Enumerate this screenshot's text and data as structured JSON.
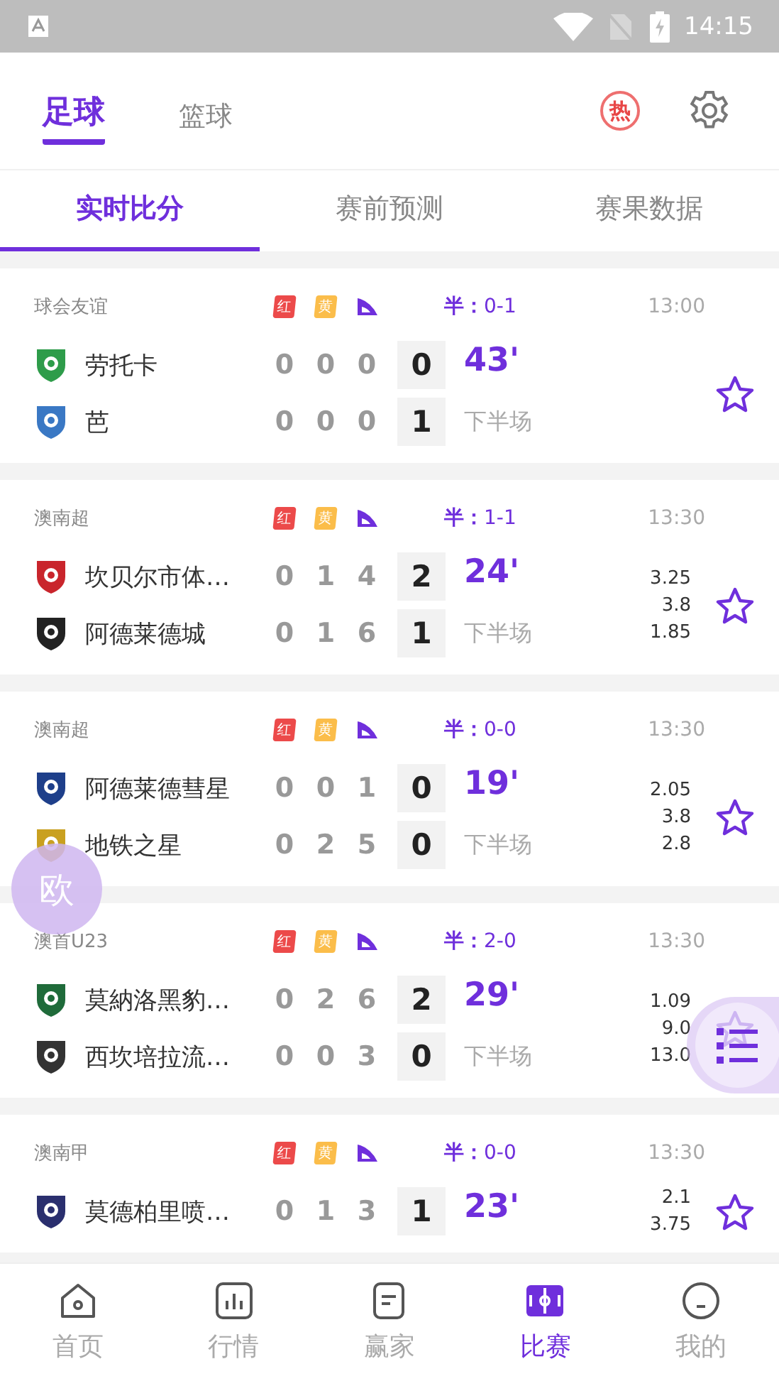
{
  "status_bar": {
    "time": "14:15"
  },
  "sport_tabs": [
    {
      "label": "足球",
      "selected": true
    },
    {
      "label": "篮球",
      "selected": false
    }
  ],
  "hot_badge": "热",
  "sub_tabs": [
    {
      "label": "实时比分",
      "selected": true
    },
    {
      "label": "赛前预测",
      "selected": false
    },
    {
      "label": "赛果数据",
      "selected": false
    }
  ],
  "matches": [
    {
      "league": "球会友谊",
      "red": "红",
      "yellow": "黄",
      "half": "**半：**0-1",
      "time": "13:00",
      "minute": "43'",
      "period": "下半场",
      "favorite": false,
      "teams": [
        {
          "name": "劳托卡",
          "stats": [
            "0",
            "0",
            "0"
          ],
          "score": "0"
        },
        {
          "name": "芭",
          "stats": [
            "0",
            "0",
            "0"
          ],
          "score": "1"
        }
      ]
    },
    {
      "league": "澳南超",
      "red": "红",
      "yellow": "黄",
      "half": "**半：**1-1",
      "time": "13:30",
      "minute": "24'",
      "period": "下半场",
      "odds": [
        "3.25",
        "3.8",
        "1.85"
      ],
      "favorite": false,
      "teams": [
        {
          "name": "坎贝尔市体…",
          "stats": [
            "0",
            "1",
            "4"
          ],
          "score": "2"
        },
        {
          "name": "阿德莱德城",
          "stats": [
            "0",
            "1",
            "6"
          ],
          "score": "1"
        }
      ]
    },
    {
      "league": "澳南超",
      "red": "红",
      "yellow": "黄",
      "half": "**半：**0-0",
      "time": "13:30",
      "minute": "19'",
      "period": "下半场",
      "odds": [
        "2.05",
        "3.8",
        "2.8"
      ],
      "favorite": false,
      "teams": [
        {
          "name": "阿德莱德彗星",
          "stats": [
            "0",
            "0",
            "1"
          ],
          "score": "0"
        },
        {
          "name": "地铁之星",
          "stats": [
            "0",
            "2",
            "5"
          ],
          "score": "0"
        }
      ]
    },
    {
      "league": "澳首U23",
      "red": "红",
      "yellow": "黄",
      "half": "**半：**2-0",
      "time": "13:30",
      "minute": "29'",
      "period": "下半场",
      "odds": [
        "1.09",
        "9.0",
        "13.0"
      ],
      "favorite": false,
      "teams": [
        {
          "name": "莫納洛黑豹…",
          "stats": [
            "0",
            "2",
            "6"
          ],
          "score": "2"
        },
        {
          "name": "西坎培拉流…",
          "stats": [
            "0",
            "0",
            "3"
          ],
          "score": "0"
        }
      ]
    },
    {
      "league": "澳南甲",
      "red": "红",
      "yellow": "黄",
      "half": "**半：**0-0",
      "time": "13:30",
      "minute": "23'",
      "odds": [
        "2.1",
        "3.75"
      ],
      "favorite": false,
      "teams": [
        {
          "name": "莫德柏里喷…",
          "stats": [
            "0",
            "1",
            "3"
          ],
          "score": "1"
        }
      ]
    }
  ],
  "odds_button": {
    "label": "欧"
  },
  "bottom_nav": [
    {
      "label": "首页",
      "selected": false
    },
    {
      "label": "行情",
      "selected": false
    },
    {
      "label": "赢家",
      "selected": false
    },
    {
      "label": "比赛",
      "selected": true
    },
    {
      "label": "我的",
      "selected": false
    }
  ]
}
